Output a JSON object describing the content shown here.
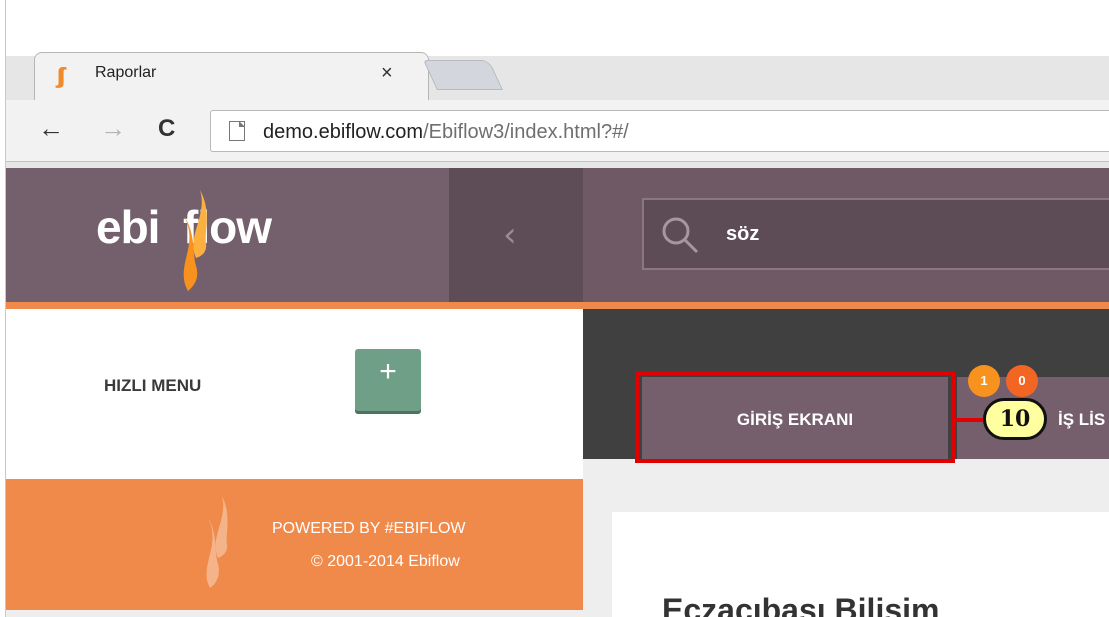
{
  "browser": {
    "tab_title": "Raporlar",
    "tab_close": "×",
    "tab_icon": "ebiflow-flame-icon",
    "url_host": "demo.ebiflow.com",
    "url_path": "/Ebiflow3/index.html?#/"
  },
  "header": {
    "logo_text": "ebi flow",
    "collapse_glyph": "‹",
    "search_value": "söz"
  },
  "sidebar": {
    "quick_menu_label": "HIZLI MENU",
    "add_label": "+",
    "powered_line1": "POWERED BY #EBIFLOW",
    "powered_line2": "© 2001-2014 Ebiflow"
  },
  "tabs": {
    "home_label": "GİRİŞ EKRANI",
    "work_label": "İŞ LİS",
    "badge_1": "1",
    "badge_2": "0"
  },
  "annotation": {
    "callout_number": "10"
  },
  "main": {
    "card_title": "Eczacıbaşı Bilişim"
  },
  "colors": {
    "brand_purple": "#755f6c",
    "brand_orange": "#f08a4b",
    "add_button_green": "#6f9f86",
    "highlight_red": "#e10000"
  }
}
